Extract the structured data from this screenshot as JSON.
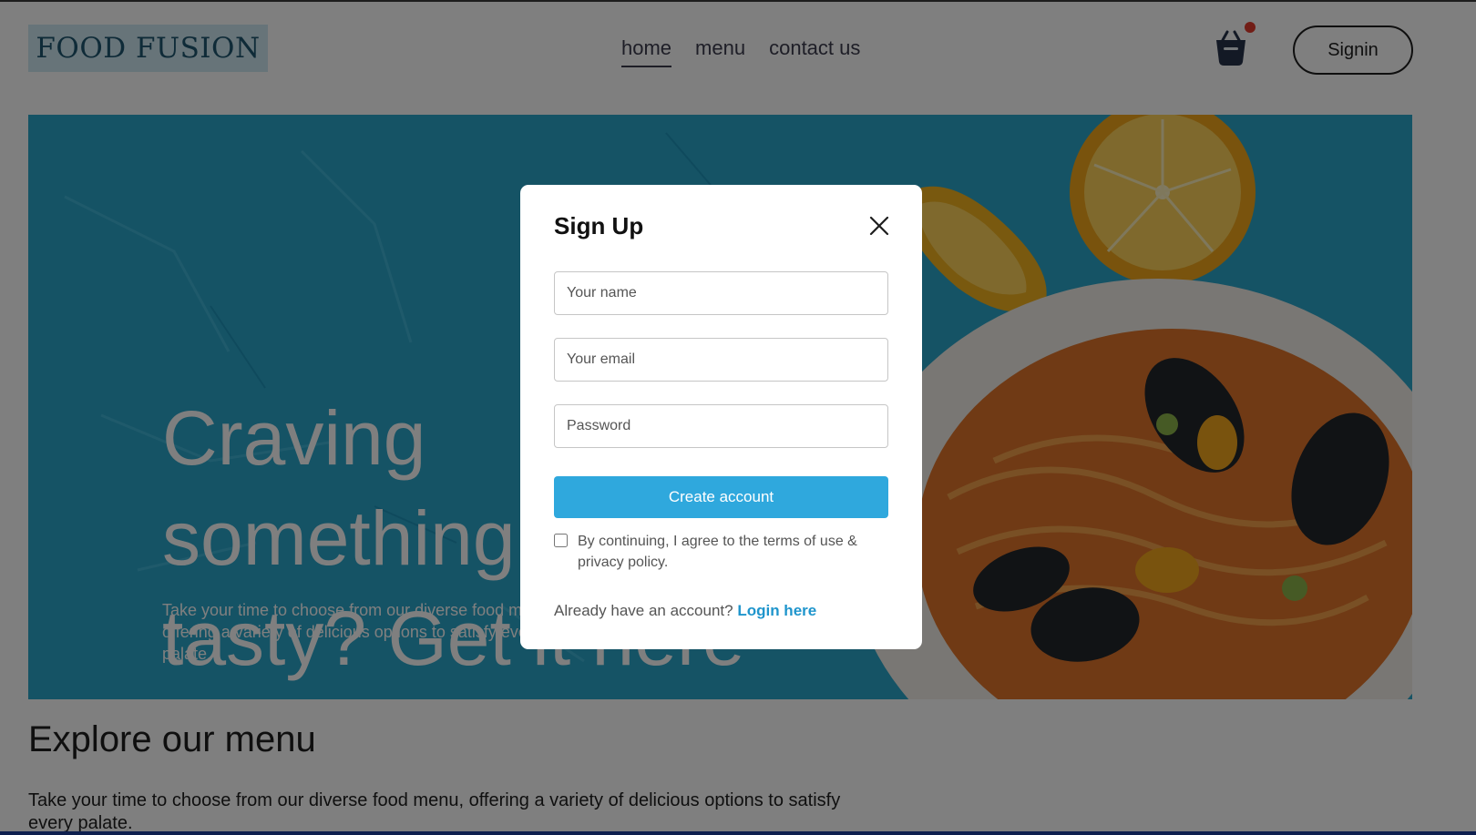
{
  "header": {
    "logo": "FOOD FUSION",
    "nav": [
      {
        "label": "home",
        "active": true
      },
      {
        "label": "menu",
        "active": false
      },
      {
        "label": "contact us",
        "active": false
      }
    ],
    "cart_icon": "basket-icon",
    "cart_has_notification": true,
    "signin_label": "Signin"
  },
  "hero": {
    "title_line1": "Craving something",
    "title_line2": "tasty? Get it here",
    "subtitle": "Take your time to choose from our diverse food menu, offering a variety of delicious options to satisfy every palate."
  },
  "explore": {
    "title": "Explore our menu",
    "text": "Take your time to choose from our diverse food menu, offering a variety of delicious options to satisfy every palate."
  },
  "modal": {
    "title": "Sign Up",
    "close_icon": "close-icon",
    "name_placeholder": "Your name",
    "email_placeholder": "Your email",
    "password_placeholder": "Password",
    "create_label": "Create account",
    "terms_text": "By continuing, I agree to the terms of use & privacy policy.",
    "terms_checked": false,
    "login_prompt": "Already have an account?",
    "login_link": "Login here"
  },
  "colors": {
    "accent": "#2fa8dd",
    "link": "#1f95cc",
    "hero_bg": "#2ba6cb",
    "notification_dot": "#e23b2d",
    "overlay": "rgba(0,0,0,0.5)"
  }
}
